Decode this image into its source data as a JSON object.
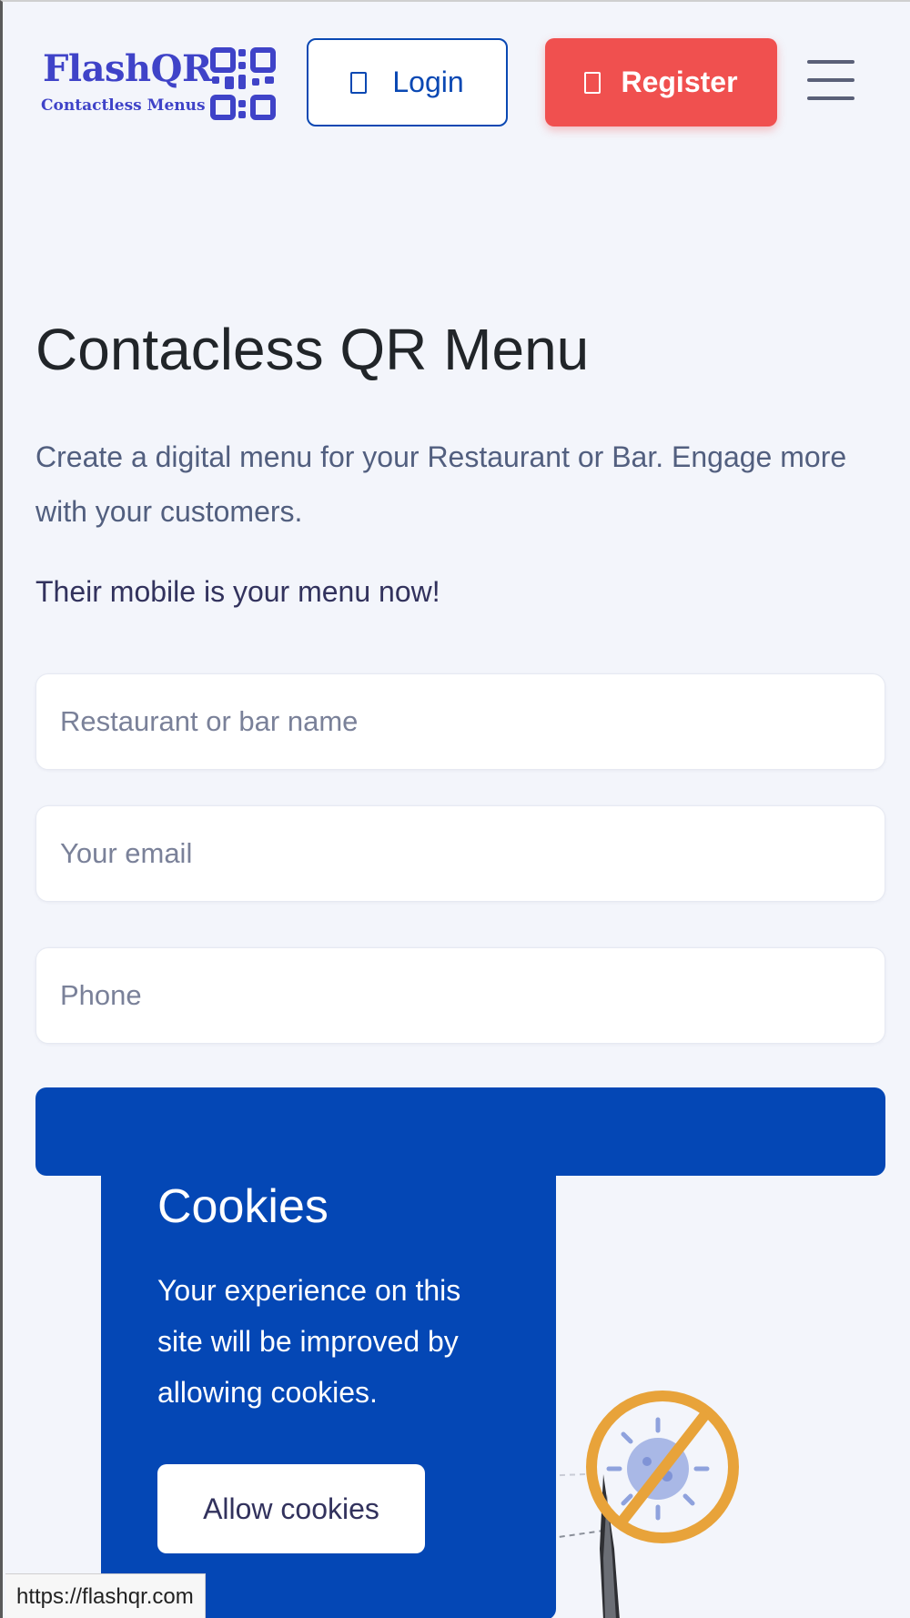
{
  "header": {
    "logo": {
      "name": "FlashQR",
      "subtitle": "Contactless Menus"
    },
    "login_label": "Login",
    "register_label": "Register"
  },
  "hero": {
    "title": "Contacless QR Menu",
    "lead": "Create a digital menu for your Restaurant or Bar. Engage more with your customers.",
    "tagline": "Their mobile is your menu now!"
  },
  "form": {
    "name_placeholder": "Restaurant or bar name",
    "email_placeholder": "Your email",
    "phone_placeholder": "Phone",
    "name_value": "",
    "email_value": "",
    "phone_value": ""
  },
  "cookies": {
    "title": "Cookies",
    "text": "Your experience on this site will be improved by allowing cookies.",
    "button_label": "Allow cookies"
  },
  "status_bar": {
    "url": "https://flashqr.com"
  },
  "colors": {
    "primary": "#0447b5",
    "register": "#f0504f",
    "background": "#f3f5fb",
    "logo": "#3f43c8",
    "virus_sign": "#e8a33a"
  },
  "icons": {
    "login": "user-icon",
    "register": "user-plus-icon",
    "menu": "hamburger-icon",
    "illustration": "no-virus-icon"
  }
}
